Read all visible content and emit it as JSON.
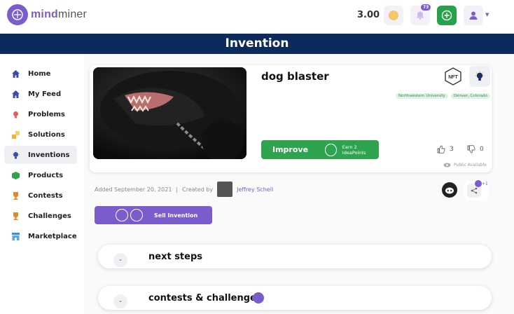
{
  "header": {
    "logo_text_1": "mind",
    "logo_text_2": "miner",
    "balance": "3.00",
    "notifications_badge": "73",
    "coin_color": "#f5c76a",
    "brand_color": "#7b5ccc"
  },
  "page_title": "Invention",
  "sidebar": {
    "items": [
      {
        "label": "Home",
        "icon": "home-icon"
      },
      {
        "label": "My Feed",
        "icon": "feed-icon"
      },
      {
        "label": "Problems",
        "icon": "problem-bulb-icon"
      },
      {
        "label": "Solutions",
        "icon": "solutions-puzzle-icon"
      },
      {
        "label": "Inventions",
        "icon": "invention-bulb-icon"
      },
      {
        "label": "Products",
        "icon": "product-box-icon"
      },
      {
        "label": "Contests",
        "icon": "trophy-icon"
      },
      {
        "label": "Challenges",
        "icon": "trophy-icon"
      },
      {
        "label": "Marketplace",
        "icon": "marketplace-icon"
      }
    ],
    "active_index": 4
  },
  "invention": {
    "title": "dog blaster",
    "tags": [
      "Northwestern University",
      "Denver, Colorado"
    ],
    "improve_label": "Improve",
    "improve_sub": "Earn 2 IdeaPoints",
    "likes": "3",
    "dislikes": "0",
    "visibility": "Public Available",
    "added_text": "Added September 20, 2021",
    "created_by_text": "Created by",
    "author": "Jeffrey Schell",
    "share_count": "+1"
  },
  "sell_button": {
    "label": "Sell Invention"
  },
  "accordions": [
    {
      "title": "next steps"
    },
    {
      "title": "contests & challenges"
    }
  ]
}
